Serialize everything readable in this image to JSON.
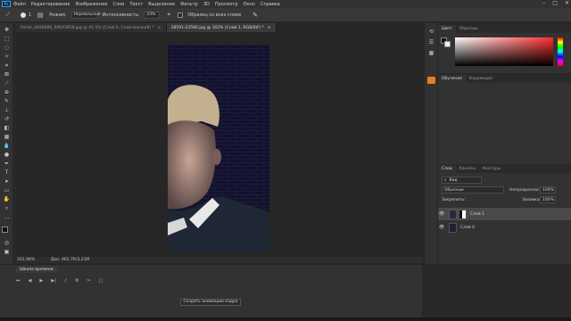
{
  "menu": {
    "logo": "Ps",
    "items": [
      "Файл",
      "Редактирование",
      "Изображение",
      "Слои",
      "Текст",
      "Выделение",
      "Фильтр",
      "3D",
      "Просмотр",
      "Окно",
      "Справка"
    ],
    "window_controls": [
      "–",
      "□",
      "✕"
    ]
  },
  "options_bar": {
    "brush_size": "1",
    "mode_label": "Режим:",
    "mode_value": "Нормальный",
    "opacity_label": "Интенсивность:",
    "opacity_value": "23%",
    "sample_all_label": "Образец со всех слоев"
  },
  "tabs": [
    {
      "label": "Polish_0828086_09643658.jpg @ 41.5% (Слой 0, Слой-маска/8) *",
      "active": false
    },
    {
      "label": "18591-23580.jpg @ 102% (Слой 1, RGB/8#) *",
      "active": true
    }
  ],
  "status": {
    "zoom": "101,98%",
    "doc": "Док: 462,7K/3,23M"
  },
  "timeline": {
    "tab_label": "Шкала времени",
    "create_button": "Создать анимацию кадра"
  },
  "color_panel": {
    "tabs": [
      "Цвет",
      "Образцы"
    ]
  },
  "learn_panel": {
    "tabs": [
      "Обучение",
      "Коррекция"
    ]
  },
  "layers_panel": {
    "tabs": [
      "Слои",
      "Каналы",
      "Контуры"
    ],
    "filter_label": "Вид",
    "blend_mode": "Обычные",
    "opacity_label": "Непрозрачность:",
    "opacity_value": "100%",
    "lock_label": "Закрепить:",
    "fill_label": "Заливка:",
    "fill_value": "100%",
    "layers": [
      {
        "name": "Слой 1",
        "selected": true
      },
      {
        "name": "Слой 0",
        "selected": false
      }
    ]
  },
  "colors": {
    "accent": "#31a8ff",
    "app_bg": "#282828",
    "panel_bg": "#323232",
    "hue_picker": "#ff2d2d"
  }
}
